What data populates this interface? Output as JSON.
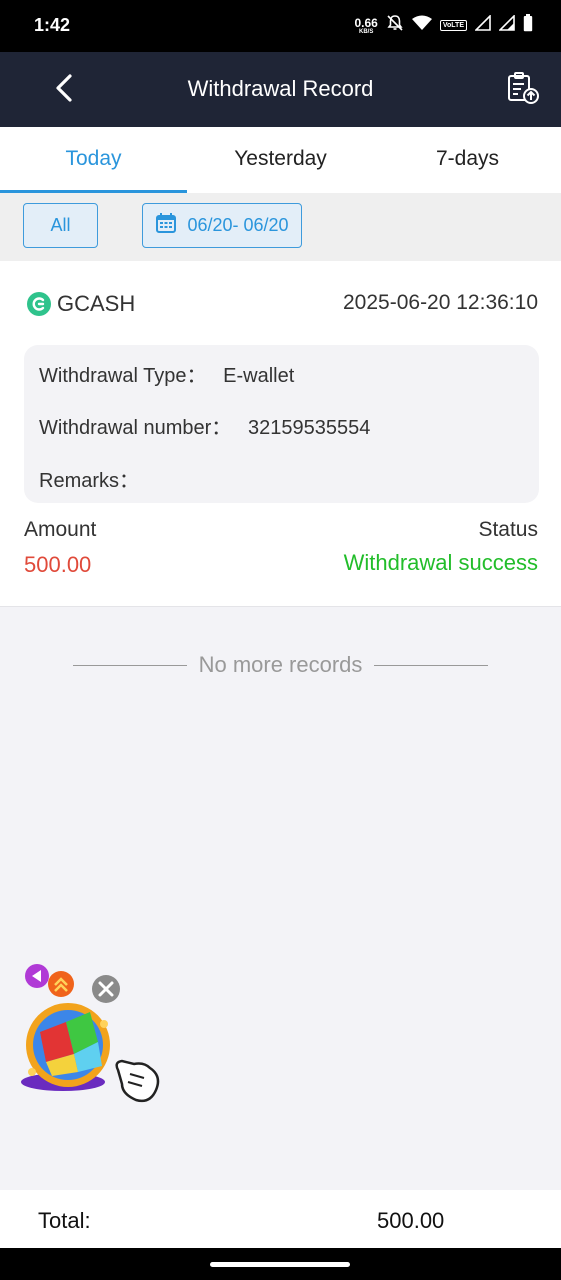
{
  "status_bar": {
    "time": "1:42",
    "net_speed": "0.66",
    "net_unit": "KB/S",
    "volte": "VoLTE"
  },
  "header": {
    "title": "Withdrawal Record",
    "back_icon": "chevron-left-icon",
    "export_icon": "clipboard-upload-icon"
  },
  "tabs": [
    {
      "label": "Today",
      "active": true
    },
    {
      "label": "Yesterday",
      "active": false
    },
    {
      "label": "7-days",
      "active": false
    }
  ],
  "filters": {
    "type": "All",
    "date_range": "06/20- 06/20",
    "date_icon": "calendar-icon"
  },
  "record": {
    "method": "GCASH",
    "datetime": "2025-06-20 12:36:10",
    "details": [
      {
        "label": "Withdrawal Type：",
        "value": "E-wallet"
      },
      {
        "label": "Withdrawal number：",
        "value": "32159535554"
      },
      {
        "label": "Remarks：",
        "value": ""
      }
    ],
    "amount_label": "Amount",
    "amount": "500.00",
    "status_label": "Status",
    "status": "Withdrawal success"
  },
  "no_more": "No more records",
  "footer": {
    "total_label": "Total:",
    "total_value": "500.00"
  },
  "colors": {
    "accent": "#2a95dc",
    "header_bg": "#1f2536",
    "amount": "#e04a3a",
    "success": "#22bd2a"
  }
}
